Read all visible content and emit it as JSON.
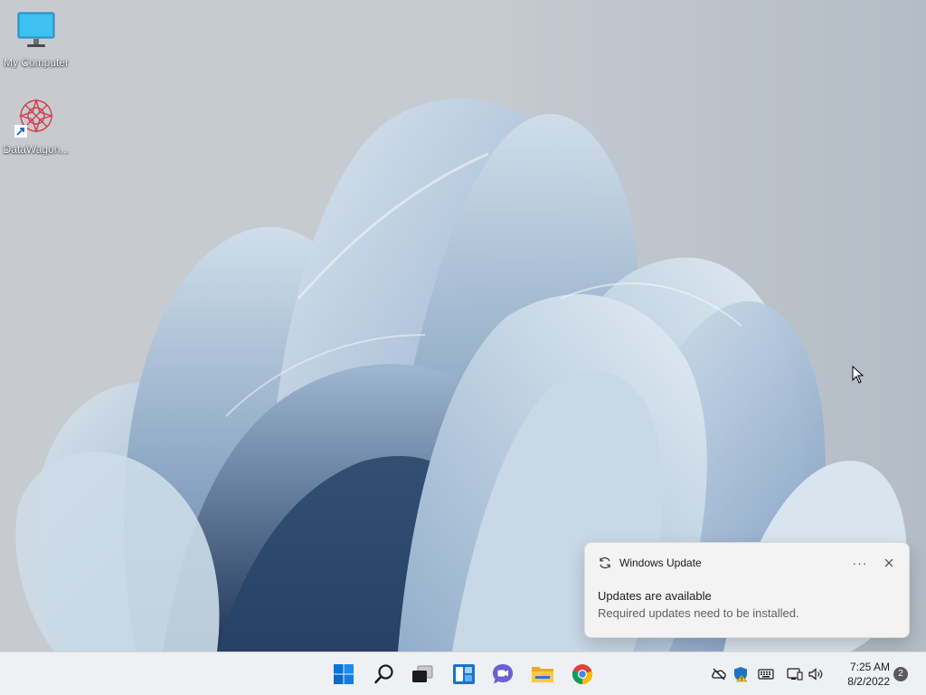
{
  "desktop": {
    "icons": [
      {
        "label": "My Computer",
        "icon": "monitor-icon"
      },
      {
        "label": "DataWagon...",
        "icon": "datawagon-app-icon"
      }
    ]
  },
  "notification": {
    "app_name": "Windows Update",
    "more_label": "···",
    "title": "Updates are available",
    "body": "Required updates need to be installed."
  },
  "taskbar": {
    "apps": [
      "start-icon",
      "search-icon",
      "task-view-icon",
      "widgets-icon",
      "teams-chat-icon",
      "file-explorer-icon",
      "chrome-icon"
    ],
    "tray": [
      "onedrive-offline-icon",
      "security-warning-icon",
      "keyboard-icon",
      "network-icon",
      "volume-icon"
    ],
    "time": "7:25 AM",
    "date": "8/2/2022",
    "notification_count": "2"
  },
  "colors": {
    "accent": "#0078d4",
    "taskbar_bg": "#eef0f3",
    "wallpaper_blue": "#6f8fb5"
  }
}
